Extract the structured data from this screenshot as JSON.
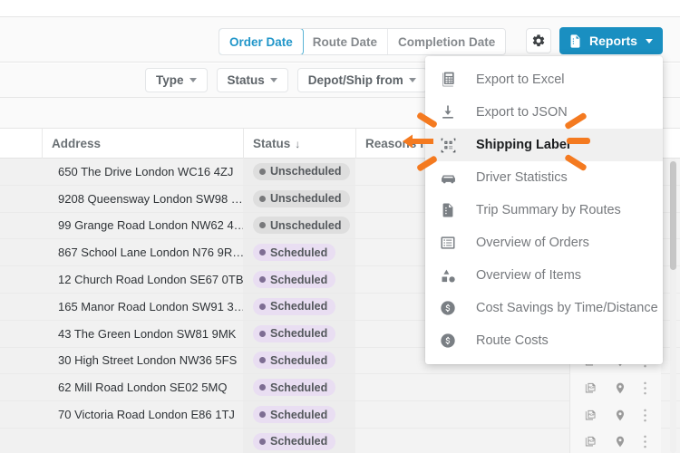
{
  "toolbar": {
    "date_tabs": [
      {
        "label": "Order Date",
        "active": true
      },
      {
        "label": "Route Date",
        "active": false
      },
      {
        "label": "Completion Date",
        "active": false
      }
    ],
    "settings_icon": "gear-icon",
    "reports_button": {
      "label": "Reports",
      "icon": "document-icon",
      "caret": "caret-down-icon",
      "color": "#1a8fc1"
    }
  },
  "filters": [
    {
      "label": "Type"
    },
    {
      "label": "Status"
    },
    {
      "label": "Depot/Ship from"
    }
  ],
  "table": {
    "columns": [
      {
        "key": "address",
        "label": "Address",
        "sort": ""
      },
      {
        "key": "status",
        "label": "Status",
        "sort": "↓"
      },
      {
        "key": "reasons",
        "label": "Reasons f",
        "sort": ""
      }
    ],
    "rows": [
      {
        "address": "650 The Drive London WC16 4ZJ",
        "status": "Unscheduled",
        "status_type": "unscheduled"
      },
      {
        "address": "9208 Queensway London SW98 …",
        "status": "Unscheduled",
        "status_type": "unscheduled"
      },
      {
        "address": "99 Grange Road London NW62 4…",
        "status": "Unscheduled",
        "status_type": "unscheduled"
      },
      {
        "address": "867 School Lane London N76 9R…",
        "status": "Scheduled",
        "status_type": "scheduled"
      },
      {
        "address": "12 Church Road London SE67 0TB",
        "status": "Scheduled",
        "status_type": "scheduled"
      },
      {
        "address": "165 Manor Road London SW91 3…",
        "status": "Scheduled",
        "status_type": "scheduled"
      },
      {
        "address": "43 The Green London SW81 9MK",
        "status": "Scheduled",
        "status_type": "scheduled"
      },
      {
        "address": "30 High Street London NW36 5FS",
        "status": "Scheduled",
        "status_type": "scheduled"
      },
      {
        "address": "62 Mill Road London SE02 5MQ",
        "status": "Scheduled",
        "status_type": "scheduled"
      },
      {
        "address": "70 Victoria Road London E86 1TJ",
        "status": "Scheduled",
        "status_type": "scheduled"
      },
      {
        "address": "",
        "status": "Scheduled",
        "status_type": "scheduled"
      }
    ],
    "row_action_icons": [
      "pdf-icon",
      "map-pin-icon",
      "more-vertical-icon"
    ]
  },
  "reports_menu": {
    "items": [
      {
        "label": "Export to Excel",
        "icon": "excel-grid-icon",
        "highlighted": false
      },
      {
        "label": "Export to JSON",
        "icon": "download-icon",
        "highlighted": false
      },
      {
        "label": "Shipping Label",
        "icon": "qr-code-icon",
        "highlighted": true
      },
      {
        "label": "Driver Statistics",
        "icon": "car-icon",
        "highlighted": false
      },
      {
        "label": "Trip Summary by Routes",
        "icon": "document-list-icon",
        "highlighted": false
      },
      {
        "label": "Overview of Orders",
        "icon": "list-box-icon",
        "highlighted": false
      },
      {
        "label": "Overview of Items",
        "icon": "shapes-icon",
        "highlighted": false
      },
      {
        "label": "Cost Savings by Time/Distance",
        "icon": "dollar-circle-icon",
        "highlighted": false
      },
      {
        "label": "Route Costs",
        "icon": "dollar-circle-icon",
        "highlighted": false
      }
    ]
  },
  "annotation": {
    "target": "Shipping Label",
    "color": "#f47a20",
    "style": "click-burst-with-left-arrow"
  }
}
